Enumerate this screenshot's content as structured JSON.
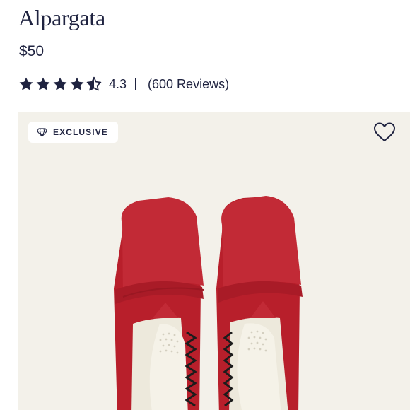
{
  "product": {
    "title": "Alpargata",
    "price": "$50"
  },
  "rating": {
    "value": "4.3",
    "stars_filled": 4.3,
    "stars_total": 5,
    "reviews_label": "(600 Reviews)"
  },
  "hero": {
    "badge_label": "EXCLUSIVE",
    "badge_icon": "diamond-icon",
    "wishlist_icon": "heart-icon",
    "image_subject": "red canvas slip-on shoes"
  },
  "colors": {
    "text": "#1f2340",
    "hero_bg": "#f3f1ea",
    "shoe_red": "#c0232f"
  }
}
